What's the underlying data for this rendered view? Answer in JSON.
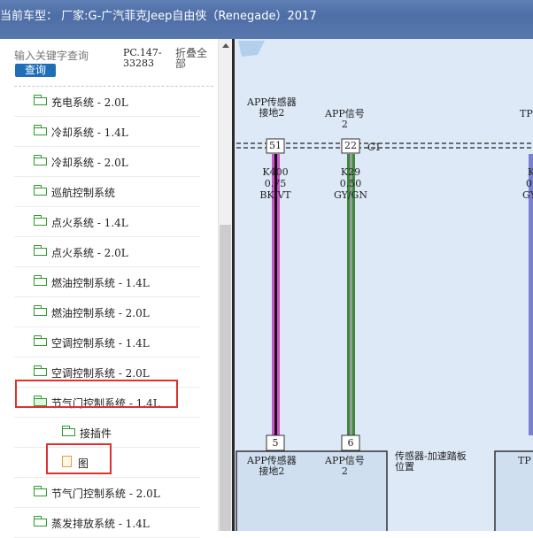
{
  "header": {
    "title": "当前车型： 厂家:G-广汽菲克Jeep自由侠（Renegade）2017"
  },
  "search": {
    "placeholder": "输入关键字查询",
    "button_label": "查询",
    "code": "PC.147-33283",
    "collapse_label": "折叠全部"
  },
  "tree": {
    "items": [
      {
        "label": "充电系统 - 2.0L",
        "icon": "folder-icon"
      },
      {
        "label": "冷却系统 - 1.4L",
        "icon": "folder-icon"
      },
      {
        "label": "冷却系统 - 2.0L",
        "icon": "folder-icon"
      },
      {
        "label": "巡航控制系统",
        "icon": "folder-icon"
      },
      {
        "label": "点火系统 - 1.4L",
        "icon": "folder-icon"
      },
      {
        "label": "点火系统 - 2.0L",
        "icon": "folder-icon"
      },
      {
        "label": "燃油控制系统 - 1.4L",
        "icon": "folder-icon"
      },
      {
        "label": "燃油控制系统 - 2.0L",
        "icon": "folder-icon"
      },
      {
        "label": "空调控制系统 - 1.4L",
        "icon": "folder-icon"
      },
      {
        "label": "空调控制系统 - 2.0L",
        "icon": "folder-icon"
      },
      {
        "label": "节气门控制系统 - 1.4L",
        "icon": "folder-open-icon",
        "expanded": true,
        "highlighted": true
      },
      {
        "label": "接插件",
        "icon": "folder-icon",
        "child": true
      },
      {
        "label": "图",
        "icon": "document-icon",
        "child": true,
        "highlighted": true
      },
      {
        "label": "节气门控制系统 - 2.0L",
        "icon": "folder-icon"
      },
      {
        "label": "蒸发排放系统 - 1.4L",
        "icon": "folder-icon"
      }
    ]
  },
  "diagram": {
    "top_labels": {
      "app_sensor_ground": "APP传感器\n接地2",
      "app_signal": "APP信号\n2",
      "tp": "TP"
    },
    "connector": "C1",
    "pins_top": [
      "51",
      "22"
    ],
    "wires": [
      {
        "code": "K400",
        "gauge": "0.75",
        "color": "BK/VT"
      },
      {
        "code": "K29",
        "gauge": "0.50",
        "color": "GY/GN"
      }
    ],
    "partial_wire_labels": [
      "K",
      "0.",
      "GY"
    ],
    "pins_bottom": [
      "5",
      "6"
    ],
    "bottom_labels": {
      "app_sensor_ground": "APP传感器\n接地2",
      "app_signal": "APP信号\n2",
      "component": "传感器-加速踏板\n位置",
      "tp": "TP"
    },
    "colors": {
      "background": "#dde9f7",
      "wire1_main": "#cc55cc",
      "wire1_stripe": "#111111",
      "wire2_main": "#3a8a3a",
      "wire2_stripe": "#9a9a9a"
    }
  }
}
